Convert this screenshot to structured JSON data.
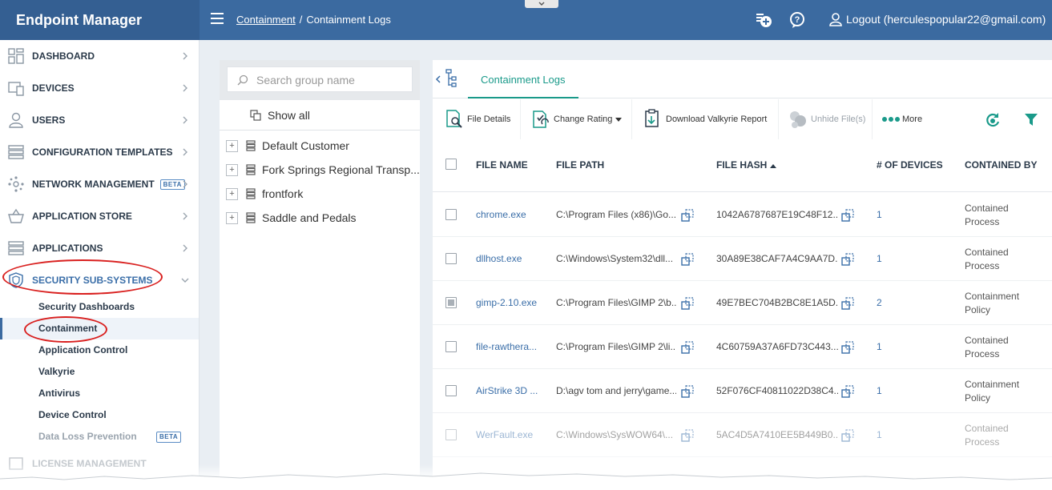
{
  "app": {
    "title": "Endpoint Manager"
  },
  "breadcrumb": {
    "parent": "Containment",
    "separator": "/",
    "current": "Containment Logs"
  },
  "header": {
    "logout_label": "Logout (herculespopular22@gmail.com)"
  },
  "sidebar": {
    "items": [
      {
        "label": "DASHBOARD",
        "icon": "dashboard-icon"
      },
      {
        "label": "DEVICES",
        "icon": "devices-icon"
      },
      {
        "label": "USERS",
        "icon": "user-icon"
      },
      {
        "label": "CONFIGURATION TEMPLATES",
        "icon": "templates-icon"
      },
      {
        "label": "NETWORK MANAGEMENT",
        "icon": "network-icon",
        "badge": "BETA"
      },
      {
        "label": "APPLICATION STORE",
        "icon": "basket-icon"
      },
      {
        "label": "APPLICATIONS",
        "icon": "applications-icon"
      },
      {
        "label": "SECURITY SUB-SYSTEMS",
        "icon": "shield-icon"
      }
    ],
    "sub_items": [
      {
        "label": "Security Dashboards"
      },
      {
        "label": "Containment"
      },
      {
        "label": "Application Control"
      },
      {
        "label": "Valkyrie"
      },
      {
        "label": "Antivirus"
      },
      {
        "label": "Device Control"
      },
      {
        "label": "Data Loss Prevention",
        "badge": "BETA"
      }
    ],
    "last_item": {
      "label": "LICENSE MANAGEMENT"
    }
  },
  "groups": {
    "search_placeholder": "Search group name",
    "show_all": "Show all",
    "items": [
      {
        "label": "Default Customer"
      },
      {
        "label": "Fork Springs Regional Transp..."
      },
      {
        "label": "frontfork"
      },
      {
        "label": "Saddle and Pedals"
      }
    ]
  },
  "tabs": {
    "active": "Containment Logs"
  },
  "toolbar": {
    "file_details": "File Details",
    "change_rating": "Change Rating",
    "download_report": "Download Valkyrie Report",
    "unhide": "Unhide File(s)",
    "more": "More"
  },
  "table": {
    "columns": [
      "FILE NAME",
      "FILE PATH",
      "FILE HASH",
      "# OF DEVICES",
      "CONTAINED BY"
    ],
    "rows": [
      {
        "name": "chrome.exe",
        "path": "C:\\Program Files (x86)\\Go...",
        "hash": "1042A6787687E19C48F12...",
        "devices": "1",
        "contained_by": "Contained Process"
      },
      {
        "name": "dllhost.exe",
        "path": "C:\\Windows\\System32\\dll...",
        "hash": "30A89E38CAF7A4C9AA7D...",
        "devices": "1",
        "contained_by": "Contained Process"
      },
      {
        "name": "gimp-2.10.exe",
        "path": "C:\\Program Files\\GIMP 2\\b...",
        "hash": "49E7BEC704B2BC8E1A5D...",
        "devices": "2",
        "contained_by": "Containment Policy"
      },
      {
        "name": "file-rawthera...",
        "path": "C:\\Program Files\\GIMP 2\\li...",
        "hash": "4C60759A37A6FD73C443...",
        "devices": "1",
        "contained_by": "Contained Process"
      },
      {
        "name": "AirStrike 3D ...",
        "path": "D:\\agv tom and jerry\\game...",
        "hash": "52F076CF40811022D38C4...",
        "devices": "1",
        "contained_by": "Containment Policy"
      },
      {
        "name": "WerFault.exe",
        "path": "C:\\Windows\\SysWOW64\\...",
        "hash": "5AC4D5A7410EE5B449B0...",
        "devices": "1",
        "contained_by": "Contained Process"
      }
    ]
  },
  "colors": {
    "header": "#3b6aa0",
    "brand": "#345f92",
    "accent": "#1a9a8a",
    "link": "#3a6ea8",
    "highlight_ring": "#d9201f"
  }
}
